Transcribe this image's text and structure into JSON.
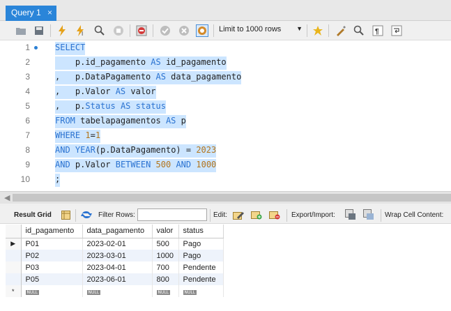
{
  "tab": {
    "title": "Query 1",
    "close": "×"
  },
  "toolbar": {
    "limit_label": "Limit to 1000 rows",
    "icons": [
      "open-folder-icon",
      "save-icon",
      "execute-icon",
      "execute-cursor-icon",
      "explain-icon",
      "stop-icon",
      "stop-on-error-icon",
      "commit-icon",
      "rollback-icon",
      "autocommit-icon",
      "limit-dropdown",
      "bookmark-star-icon",
      "beautify-icon",
      "find-icon",
      "invisible-chars-icon",
      "wrap-icon"
    ]
  },
  "editor": {
    "lines": [
      {
        "n": "1",
        "t": [
          [
            "kw",
            "SELECT"
          ]
        ]
      },
      {
        "n": "2",
        "t": [
          [
            "",
            "    p.id_pagamento "
          ],
          [
            "kw",
            "AS"
          ],
          [
            "",
            " id_pagamento"
          ]
        ]
      },
      {
        "n": "3",
        "t": [
          [
            "",
            ",   p.DataPagamento "
          ],
          [
            "kw",
            "AS"
          ],
          [
            "",
            " data_pagamento"
          ]
        ]
      },
      {
        "n": "4",
        "t": [
          [
            "",
            ",   p.Valor "
          ],
          [
            "kw",
            "AS"
          ],
          [
            "",
            " valor"
          ]
        ]
      },
      {
        "n": "5",
        "t": [
          [
            "",
            ",   p."
          ],
          [
            "kw",
            "Status"
          ],
          [
            "",
            " "
          ],
          [
            "kw",
            "AS"
          ],
          [
            "",
            " "
          ],
          [
            "kw",
            "status"
          ]
        ]
      },
      {
        "n": "6",
        "t": [
          [
            "kw",
            "FROM"
          ],
          [
            "",
            " tabelapagamentos "
          ],
          [
            "kw",
            "AS"
          ],
          [
            "",
            " p"
          ]
        ]
      },
      {
        "n": "7",
        "t": [
          [
            "kw",
            "WHERE"
          ],
          [
            "",
            " "
          ],
          [
            "num",
            "1"
          ],
          [
            "",
            "="
          ],
          [
            "num",
            "1"
          ]
        ]
      },
      {
        "n": "8",
        "t": [
          [
            "kw",
            "AND"
          ],
          [
            "",
            " "
          ],
          [
            "kw",
            "YEAR"
          ],
          [
            "",
            "(p.DataPagamento) = "
          ],
          [
            "num",
            "2023"
          ]
        ]
      },
      {
        "n": "9",
        "t": [
          [
            "kw",
            "AND"
          ],
          [
            "",
            " p.Valor "
          ],
          [
            "kw",
            "BETWEEN"
          ],
          [
            "",
            " "
          ],
          [
            "num",
            "500"
          ],
          [
            "",
            " "
          ],
          [
            "kw",
            "AND"
          ],
          [
            "",
            " "
          ],
          [
            "num",
            "1000"
          ]
        ]
      },
      {
        "n": "10",
        "t": [
          [
            "",
            ";"
          ]
        ]
      }
    ]
  },
  "results": {
    "result_grid": "Result Grid",
    "filter_rows": "Filter Rows:",
    "edit": "Edit:",
    "export_import": "Export/Import:",
    "wrap_cell": "Wrap Cell Content:",
    "columns": [
      "id_pagamento",
      "data_pagamento",
      "valor",
      "status"
    ],
    "rows": [
      [
        "P01",
        "2023-02-01",
        "500",
        "Pago"
      ],
      [
        "P02",
        "2023-03-01",
        "1000",
        "Pago"
      ],
      [
        "P03",
        "2023-04-01",
        "700",
        "Pendente"
      ],
      [
        "P05",
        "2023-06-01",
        "800",
        "Pendente"
      ]
    ],
    "null_label": "NULL",
    "current_row_marker": "▶",
    "new_row_marker": "*"
  },
  "colors": {
    "keyword": "#2b73d1",
    "number": "#b3741a",
    "selection": "#cce5ff",
    "tab": "#2a85d9"
  }
}
